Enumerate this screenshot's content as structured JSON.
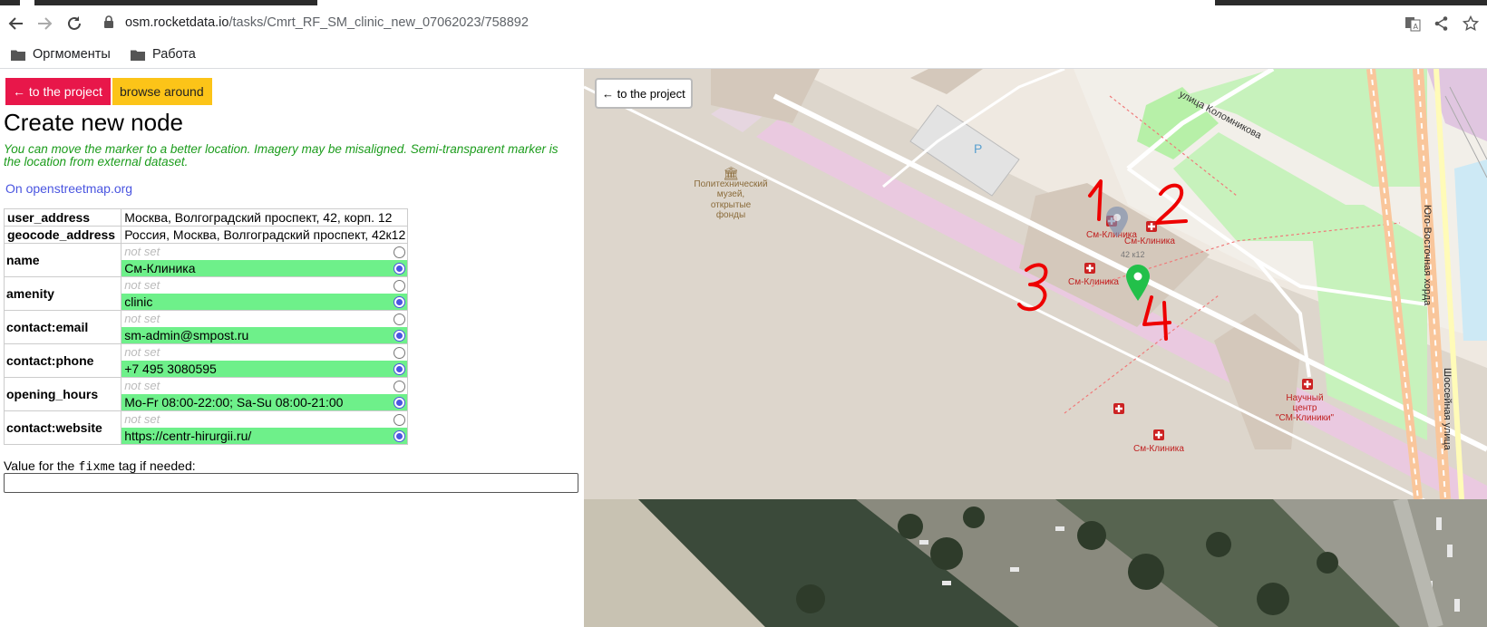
{
  "browser": {
    "url_host": "osm.rocketdata.io",
    "url_path": "/tasks/Cmrt_RF_SM_clinic_new_07062023/758892",
    "bookmarks": [
      "Оргмоменты",
      "Работа"
    ]
  },
  "left": {
    "btn_project": "← to the project",
    "btn_browse": "browse around",
    "title": "Create new node",
    "hint": "You can move the marker to a better location. Imagery may be misaligned. Semi-transparent marker is the location from external dataset.",
    "osm_link": "On openstreetmap.org",
    "address_rows": [
      {
        "key": "user_address",
        "value": "Москва, Волгоградский проспект, 42, корп. 12"
      },
      {
        "key": "geocode_address",
        "value": "Россия, Москва, Волгоградский проспект, 42к12"
      }
    ],
    "not_set_label": "not set",
    "tag_rows": [
      {
        "key": "name",
        "value": "См-Клиника"
      },
      {
        "key": "amenity",
        "value": "clinic"
      },
      {
        "key": "contact:email",
        "value": "sm-admin@smpost.ru"
      },
      {
        "key": "contact:phone",
        "value": "+7 495 3080595"
      },
      {
        "key": "opening_hours",
        "value": "Mo-Fr 08:00-22:00; Sa-Su 08:00-21:00"
      },
      {
        "key": "contact:website",
        "value": "https://centr-hirurgii.ru/"
      }
    ],
    "fixme_prefix": "Value for the ",
    "fixme_code": "fixme",
    "fixme_suffix": " tag if needed:",
    "fixme_value": ""
  },
  "map": {
    "back_button": "← to the project",
    "street_kolomnikova": "улица Коломникова",
    "museum": [
      "Политехнический",
      "музей,",
      "открытые",
      "фонды"
    ],
    "clinic_label": "См-Клиника",
    "house_number": "42 к12",
    "sci_center": [
      "Научный",
      "центр",
      "\"СМ-Клиники\""
    ],
    "road_vertical_1": "Юго-Восточная хорда",
    "road_vertical_2": "Шоссейная улица",
    "parking": "P",
    "annotations": [
      "1",
      "2",
      "3",
      "4"
    ]
  }
}
